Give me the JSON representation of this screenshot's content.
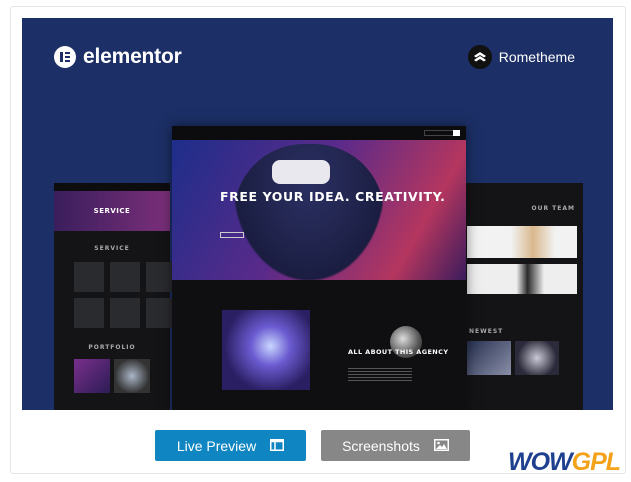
{
  "banner": {
    "elementor_logo": "elementor",
    "rometheme_logo": "Rometheme",
    "mockup": {
      "hero_headline": "FREE YOUR IDEA. CREATIVITY.",
      "about_heading": "ALL ABOUT THIS AGENCY",
      "service_heading": "SERVICE",
      "service_section": "SERVICE",
      "portfolio_section": "PORTFOLIO",
      "team_heading": "OUR TEAM",
      "newest_heading": "NEWEST"
    }
  },
  "actions": {
    "live_preview_label": "Live Preview",
    "screenshots_label": "Screenshots"
  },
  "watermark": {
    "part1": "WOW",
    "part2": "GPL"
  },
  "colors": {
    "banner_bg": "#1c2f66",
    "live_preview_bg": "#0f85c1",
    "screenshots_bg": "#878787",
    "wow_blue": "#1f3f8f",
    "gpl_orange": "#f3a21a"
  }
}
